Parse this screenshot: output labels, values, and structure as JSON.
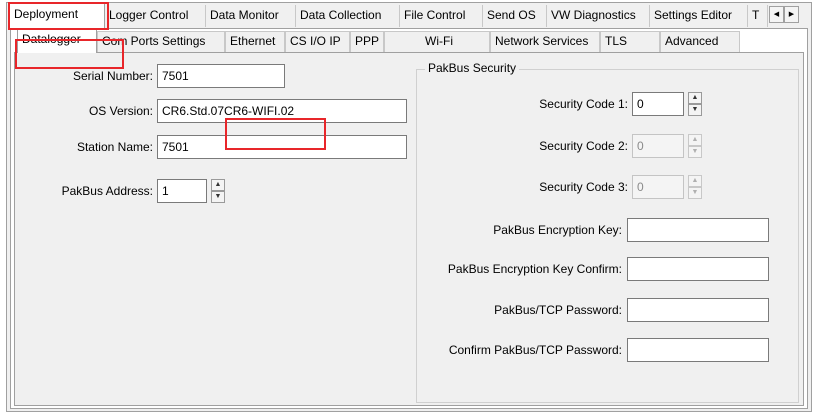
{
  "main_tabs": [
    "Deployment",
    "Logger Control",
    "Data Monitor",
    "Data Collection",
    "File Control",
    "Send OS",
    "VW Diagnostics",
    "Settings Editor",
    "T"
  ],
  "sub_tabs": [
    "Datalogger",
    "Com Ports Settings",
    "Ethernet",
    "CS I/O IP",
    "PPP",
    "Wi-Fi",
    "Network Services",
    "TLS",
    "Advanced"
  ],
  "scroll_left": "◀",
  "scroll_right": "▶",
  "datalogger": {
    "serial_number_label": "Serial Number:",
    "serial_number": "7501",
    "os_version_label": "OS Version:",
    "os_version": "CR6.Std.07",
    "os_version_suffix": "CR6-WIFI.02",
    "station_name_label": "Station Name:",
    "station_name": "7501",
    "pakbus_address_label": "PakBus Address:",
    "pakbus_address": "1"
  },
  "security": {
    "group_title": "PakBus Security",
    "code1_label": "Security Code 1:",
    "code1": "0",
    "code2_label": "Security Code 2:",
    "code2": "0",
    "code3_label": "Security Code 3:",
    "code3": "0",
    "enc_key_label": "PakBus Encryption Key:",
    "enc_key": "",
    "enc_key_confirm_label": "PakBus Encryption Key Confirm:",
    "enc_key_confirm": "",
    "tcp_password_label": "PakBus/TCP Password:",
    "tcp_password": "",
    "confirm_tcp_password_label": "Confirm PakBus/TCP Password:",
    "confirm_tcp_password": ""
  },
  "spin_up": "▲",
  "spin_down": "▼",
  "colors": {
    "highlight": "#e8262a",
    "panel": "#f0f0f0",
    "border": "#a0a0a0"
  }
}
